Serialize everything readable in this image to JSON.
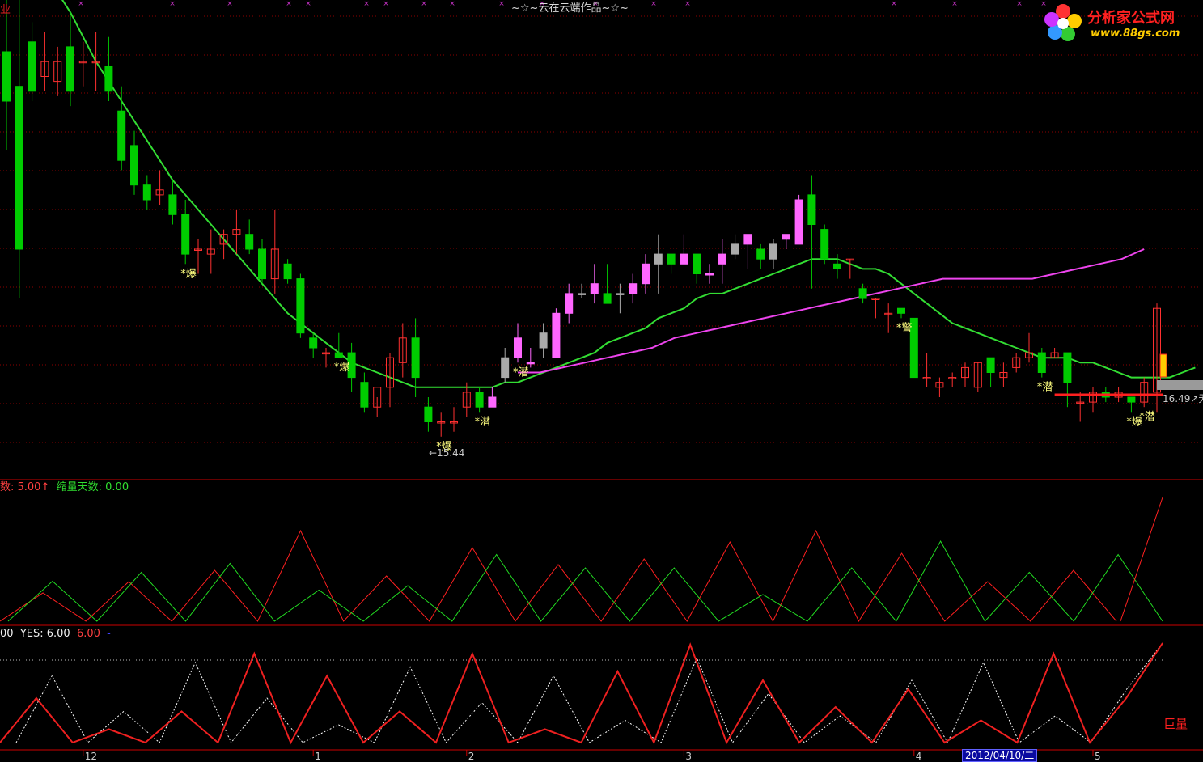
{
  "header": {
    "title": "~☆~云在云端作品~☆~",
    "corner_tag": "业",
    "logo_text": "分析家公式网",
    "logo_url": "www.88gs.com"
  },
  "colors": {
    "up": "#ff3030",
    "down": "#00cc00",
    "ma_green": "#33dd33",
    "ma_magenta": "#ee44ee",
    "grid": "#8b0000",
    "signal_text": "#ffff80"
  },
  "price_panel": {
    "low_label": "←15.44",
    "right_label": "16.49",
    "right_label_suffix": "↗无线",
    "signals": [
      {
        "text": "*爆",
        "bar": 14
      },
      {
        "text": "*爆",
        "bar": 26
      },
      {
        "text": "*爆",
        "bar": 34
      },
      {
        "text": "*潜",
        "bar": 37
      },
      {
        "text": "*潜",
        "bar": 40
      },
      {
        "text": "*警",
        "bar": 70
      },
      {
        "text": "*潜",
        "bar": 81
      },
      {
        "text": "*爆",
        "bar": 88
      },
      {
        "text": "*潜",
        "bar": 89
      }
    ]
  },
  "indicator1": {
    "legend_a": "数: 5.00",
    "legend_a_arrow": "↑",
    "legend_b": "缩量天数: 0.00"
  },
  "indicator2": {
    "legend_a": "00",
    "legend_b": "YES: 6.00",
    "legend_c": "6.00",
    "legend_d": "-",
    "marker": "巨量"
  },
  "x_axis": {
    "ticks": [
      {
        "label": "12",
        "bar": 6
      },
      {
        "label": "1",
        "bar": 24
      },
      {
        "label": "2",
        "bar": 36
      },
      {
        "label": "3",
        "bar": 53
      },
      {
        "label": "4",
        "bar": 71
      },
      {
        "label": "5",
        "bar": 85
      }
    ],
    "cursor_date": "2012/04/10/二"
  },
  "chart_data": {
    "type": "candlestick",
    "title": "~☆~云在云端作品~☆~",
    "price_low_marker": 15.44,
    "price_right_marker": 16.49,
    "ohlc": [
      [
        60,
        50,
        100,
        40
      ],
      [
        53,
        20,
        80,
        10
      ],
      [
        62,
        52,
        66,
        50
      ],
      [
        55,
        58,
        64,
        52
      ],
      [
        54,
        58,
        61,
        51
      ],
      [
        61,
        52,
        68,
        49
      ],
      [
        58,
        58,
        62,
        53
      ],
      [
        58,
        58,
        64,
        52
      ],
      [
        57,
        52,
        63,
        50
      ],
      [
        48,
        38,
        53,
        36
      ],
      [
        41,
        33,
        44,
        31
      ],
      [
        33,
        30,
        35,
        28
      ],
      [
        31,
        32,
        36,
        29
      ],
      [
        31,
        27,
        34,
        25
      ],
      [
        27,
        19,
        30,
        17
      ],
      [
        20,
        20,
        22,
        15
      ],
      [
        19,
        20,
        24,
        15
      ],
      [
        21,
        23,
        24,
        18
      ],
      [
        23,
        24,
        28,
        19
      ],
      [
        23,
        20,
        26,
        19
      ],
      [
        20,
        14,
        22,
        13
      ],
      [
        14,
        20,
        28,
        11
      ],
      [
        17,
        14,
        18,
        13
      ],
      [
        14,
        3,
        15,
        2
      ],
      [
        2,
        0,
        3,
        -2
      ],
      [
        -1,
        -1,
        0,
        -4
      ],
      [
        -1,
        -2,
        3,
        -2
      ],
      [
        -1,
        -6,
        1,
        -9
      ],
      [
        -7,
        -12,
        -5,
        -13
      ],
      [
        -12,
        -8,
        -10,
        -14
      ],
      [
        -8,
        -2,
        -1,
        -12
      ],
      [
        -3,
        2,
        5,
        -6
      ],
      [
        2,
        -6,
        6,
        -10
      ],
      [
        -12,
        -15,
        -10,
        -17
      ],
      [
        -15,
        -15,
        -13,
        -18
      ],
      [
        -15,
        -15,
        -12,
        -17
      ],
      [
        -12,
        -9,
        -7,
        -14
      ],
      [
        -9,
        -12,
        -8,
        -13
      ],
      [
        -12,
        -10,
        -8,
        -12
      ],
      [
        -6,
        -2,
        0,
        -7
      ],
      [
        -2,
        2,
        5,
        -3
      ],
      [
        -3,
        -3,
        0,
        -4
      ],
      [
        0,
        3,
        5,
        -2
      ],
      [
        -2,
        7,
        8,
        -2
      ],
      [
        7,
        11,
        13,
        5
      ],
      [
        11,
        11,
        13,
        10
      ],
      [
        11,
        13,
        17,
        9
      ],
      [
        11,
        9,
        17,
        9
      ],
      [
        11,
        11,
        13,
        7
      ],
      [
        11,
        13,
        15,
        9
      ],
      [
        13,
        17,
        19,
        11
      ],
      [
        17,
        19,
        23,
        11
      ],
      [
        19,
        17,
        19,
        15
      ],
      [
        17,
        19,
        23,
        17
      ],
      [
        19,
        15,
        19,
        13
      ],
      [
        15,
        15,
        17,
        13
      ],
      [
        17,
        19,
        22,
        13
      ],
      [
        19,
        21,
        23,
        18
      ],
      [
        21,
        23,
        23,
        16
      ],
      [
        20,
        18,
        21,
        16
      ],
      [
        18,
        21,
        22,
        16
      ],
      [
        22,
        23,
        23,
        20
      ],
      [
        21,
        30,
        31,
        21
      ],
      [
        31,
        25,
        35,
        12
      ],
      [
        24,
        18,
        25,
        17
      ],
      [
        17,
        16,
        19,
        14
      ],
      [
        18,
        18,
        18,
        14
      ],
      [
        12,
        10,
        13,
        9
      ],
      [
        10,
        10,
        10,
        6
      ],
      [
        7,
        7,
        9,
        3
      ],
      [
        8,
        7,
        8,
        6
      ],
      [
        6,
        -6,
        -3,
        -6
      ],
      [
        -6,
        -6,
        -1,
        -8
      ],
      [
        -8,
        -7,
        -6,
        -10
      ],
      [
        -6,
        -6,
        -5,
        -8
      ],
      [
        -6,
        -4,
        -3,
        -8
      ],
      [
        -8,
        -3,
        -3,
        -9
      ],
      [
        -2,
        -5,
        -4,
        -8
      ],
      [
        -6,
        -5,
        -3,
        -8
      ],
      [
        -4,
        -2,
        -1,
        -5
      ],
      [
        -2,
        -1,
        3,
        -3
      ],
      [
        -1,
        -5,
        0,
        -6
      ],
      [
        -2,
        -1,
        0,
        -2
      ],
      [
        -1,
        -7,
        -5,
        -12
      ],
      [
        -11,
        -11,
        -9,
        -15
      ],
      [
        -11,
        -9,
        -8,
        -13
      ],
      [
        -9,
        -10,
        -8,
        -11
      ],
      [
        -10,
        -9,
        -8,
        -11
      ],
      [
        -10,
        -11,
        -10,
        -13
      ],
      [
        -11,
        -7,
        -6,
        -12
      ],
      [
        -9,
        8,
        9,
        -13
      ]
    ],
    "ma_slow_path": [
      88,
      84,
      80,
      76,
      72,
      68,
      63,
      58,
      54,
      50,
      46,
      42,
      38,
      34,
      31,
      28,
      25,
      22,
      19,
      16,
      13,
      10,
      7,
      5,
      3,
      1,
      -1,
      -3,
      -4,
      -5,
      -6,
      -7,
      -8,
      -8,
      -8,
      -8,
      -8,
      -8,
      -8,
      -7,
      -7,
      -6,
      -5,
      -4,
      -3,
      -2,
      -1,
      1,
      2,
      3,
      4,
      6,
      7,
      8,
      10,
      11,
      11,
      12,
      13,
      14,
      15,
      16,
      17,
      18,
      18,
      18,
      17,
      16,
      16,
      15,
      13,
      11,
      9,
      7,
      5,
      4,
      3,
      2,
      1,
      0,
      -1,
      -2,
      -2,
      -2,
      -3,
      -3,
      -4,
      -5,
      -6,
      -6,
      -6,
      -6,
      -5,
      -4
    ],
    "ma_magenta_path": [
      -5,
      -5,
      -4,
      -3,
      -2,
      -1,
      0,
      2,
      3,
      4,
      5,
      6,
      7,
      8,
      9,
      10,
      11,
      12,
      13,
      14,
      14,
      14,
      14,
      14,
      15,
      16,
      17,
      18,
      20
    ],
    "indicator1_red": [
      5,
      7,
      9,
      16,
      8,
      13,
      10,
      11,
      14,
      16,
      12,
      7,
      9
    ],
    "indicator1_green": [
      9,
      11,
      13,
      7,
      8,
      15,
      12,
      12,
      6,
      12,
      18,
      11,
      15
    ],
    "indicator2_red": [
      10,
      3,
      7,
      20,
      15,
      7,
      20,
      3,
      16,
      22,
      14,
      8,
      12,
      5,
      20,
      10
    ],
    "indicator2_white": [
      15,
      7,
      18,
      10,
      4,
      17,
      9,
      15,
      5,
      19,
      11,
      6,
      14,
      18,
      6,
      12
    ],
    "volume_cursor": "2012/04/10/二"
  }
}
